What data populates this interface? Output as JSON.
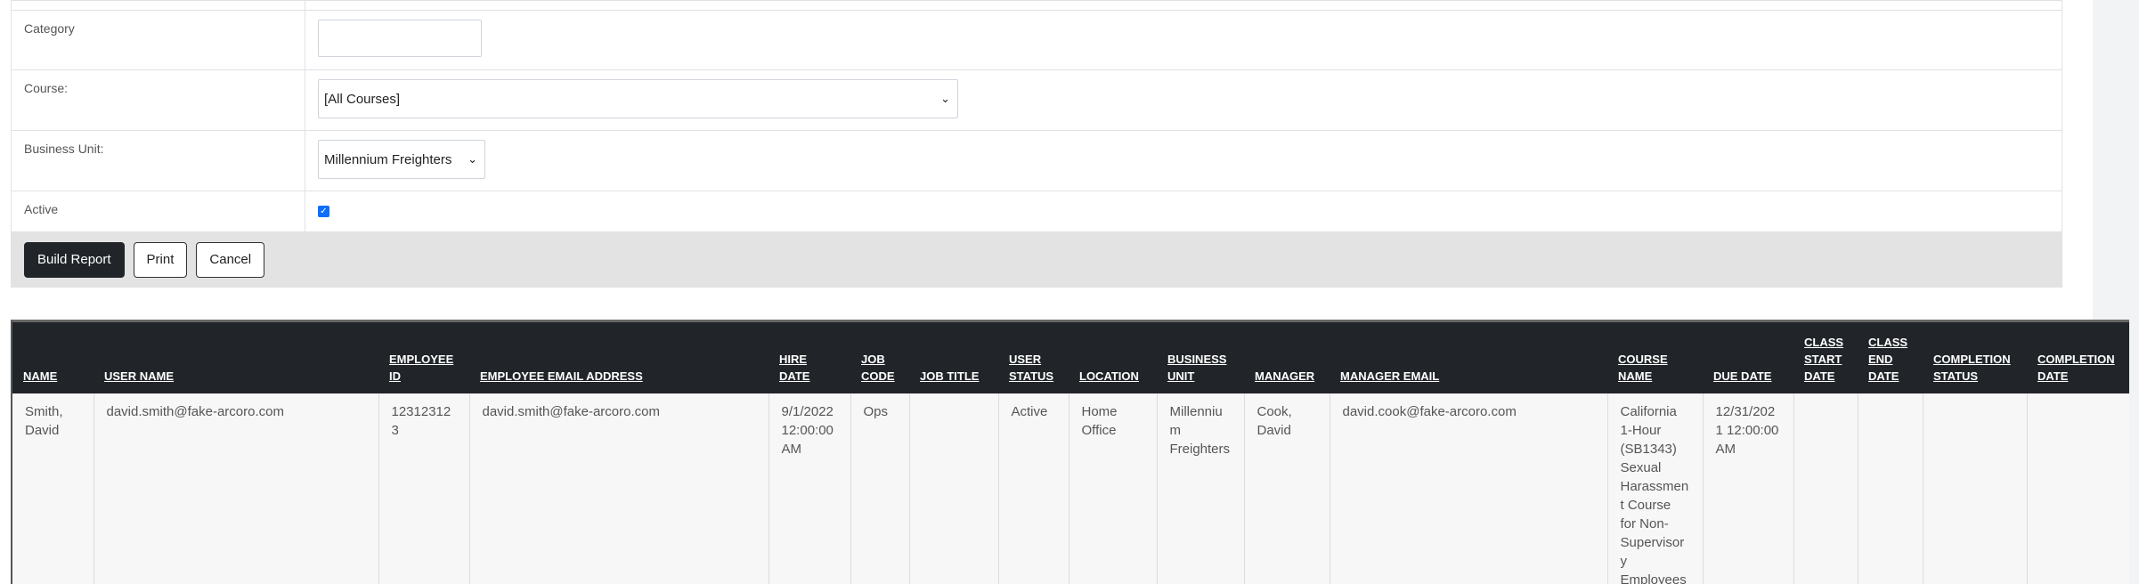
{
  "form": {
    "category_label": "Category",
    "category_value": "",
    "course_label": "Course:",
    "course_selected": "[All Courses]",
    "business_unit_label": "Business Unit:",
    "business_unit_selected": "Millennium Freighters",
    "active_label": "Active",
    "active_checked": true
  },
  "buttons": {
    "build_report": "Build Report",
    "print": "Print",
    "cancel": "Cancel"
  },
  "report": {
    "headers": [
      "NAME",
      "USER NAME",
      "EMPLOYEE ID",
      "EMPLOYEE EMAIL ADDRESS",
      "HIRE DATE",
      "JOB CODE",
      "JOB TITLE",
      "USER STATUS",
      "LOCATION",
      "BUSINESS UNIT",
      "MANAGER",
      "MANAGER EMAIL",
      "COURSE NAME",
      "DUE DATE",
      "CLASS START DATE",
      "CLASS END DATE",
      "COMPLETION STATUS",
      "COMPLETION DATE"
    ],
    "rows": [
      [
        "Smith, David",
        "david.smith@fake-arcoro.com",
        "123123123",
        "david.smith@fake-arcoro.com",
        "9/1/2022 12:00:00 AM",
        "Ops",
        "",
        "Active",
        "Home Office",
        "Millennium Freighters",
        "Cook, David",
        "david.cook@fake-arcoro.com",
        "California 1-Hour (SB1343) Sexual Harassment Course for Non-Supervisory Employees",
        "12/31/2021 12:00:00 AM",
        "",
        "",
        "",
        ""
      ]
    ]
  },
  "colors": {
    "header_bg": "#212529",
    "button_dark": "#212529",
    "checkbox": "#0d6efd"
  }
}
